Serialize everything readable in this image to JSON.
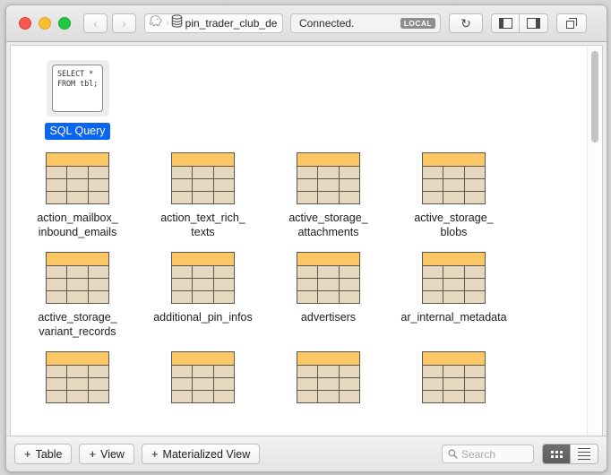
{
  "window": {
    "traffic_lights": [
      "close",
      "minimize",
      "zoom"
    ]
  },
  "toolbar": {
    "back_label": "‹",
    "forward_label": "›",
    "server_icon": "elephant-icon",
    "database_icon": "database-icon",
    "database_name": "pin_trader_club_develc",
    "status_text": "Connected.",
    "status_badge": "LOCAL",
    "refresh_label": "↻",
    "left_panel_icon": "left-sidebar-icon",
    "right_panel_icon": "right-sidebar-icon",
    "window_stack_icon": "window-stack-icon"
  },
  "content": {
    "rows": [
      {
        "items": [
          {
            "type": "sql_query",
            "name": "SQL Query",
            "icon_text": "SELECT *\nFROM tbl;",
            "selected": true
          }
        ]
      },
      {
        "items": [
          {
            "type": "table",
            "name": "action_mailbox_\ninbound_emails",
            "selected": false
          },
          {
            "type": "table",
            "name": "action_text_rich_\ntexts",
            "selected": false
          },
          {
            "type": "table",
            "name": "active_storage_\nattachments",
            "selected": false
          },
          {
            "type": "table",
            "name": "active_storage_\nblobs",
            "selected": false
          }
        ]
      },
      {
        "items": [
          {
            "type": "table",
            "name": "active_storage_\nvariant_records",
            "selected": false
          },
          {
            "type": "table",
            "name": "additional_pin_infos",
            "selected": false
          },
          {
            "type": "table",
            "name": "advertisers",
            "selected": false
          },
          {
            "type": "table",
            "name": "ar_internal_metadata",
            "selected": false
          }
        ]
      },
      {
        "items": [
          {
            "type": "table",
            "name": "",
            "selected": false
          },
          {
            "type": "table",
            "name": "",
            "selected": false
          },
          {
            "type": "table",
            "name": "",
            "selected": false
          },
          {
            "type": "table",
            "name": "",
            "selected": false
          }
        ]
      }
    ]
  },
  "bottombar": {
    "add_table_label": "Table",
    "add_view_label": "View",
    "add_materialized_view_label": "Materialized View",
    "plus_symbol": "+",
    "search_placeholder": "Search",
    "view_mode": "grid"
  },
  "colors": {
    "selection_blue": "#0a66f0",
    "table_header_orange": "#fbc765",
    "table_cell_tan": "#e6d8be",
    "table_border": "#5c5651",
    "badge_gray": "#8e8e8e"
  }
}
